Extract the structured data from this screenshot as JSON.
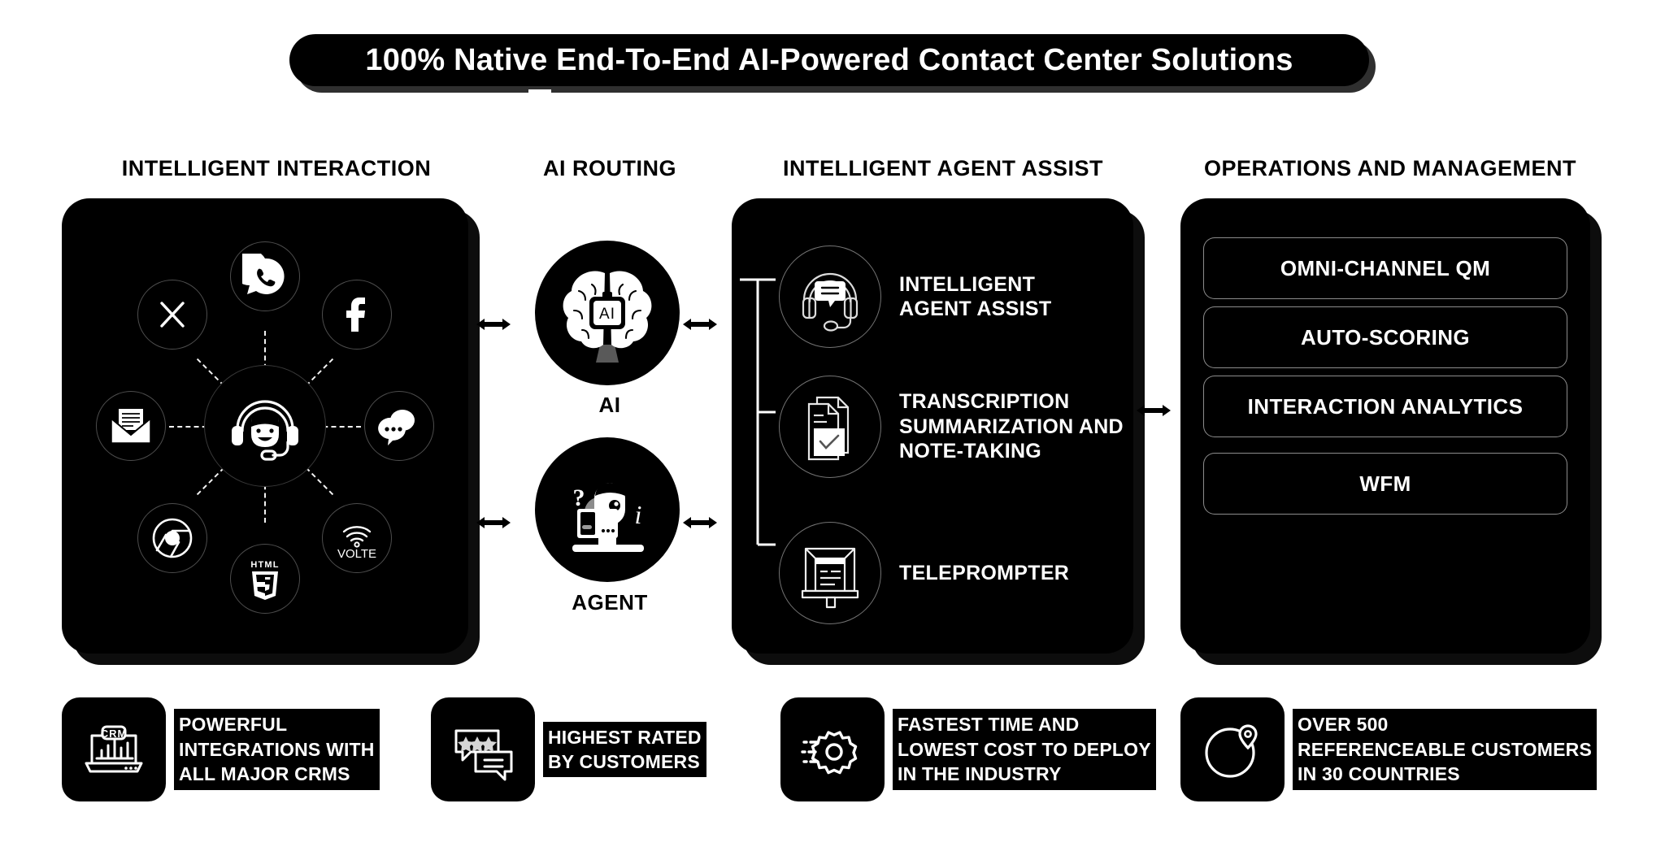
{
  "title": "100% Native End-To-End AI-Powered Contact Center Solutions",
  "columns": {
    "interaction": "INTELLIGENT INTERACTION",
    "routing": "AI ROUTING",
    "assist": "INTELLIGENT AGENT ASSIST",
    "operations": "OPERATIONS AND MANAGEMENT"
  },
  "interaction": {
    "center_icon": "agent-headset-icon",
    "channels": [
      {
        "name": "whatsapp-icon",
        "label": "WhatsApp"
      },
      {
        "name": "x-twitter-icon",
        "label": "X"
      },
      {
        "name": "facebook-icon",
        "label": "Facebook"
      },
      {
        "name": "email-icon",
        "label": "Email"
      },
      {
        "name": "chat-icon",
        "label": "Chat"
      },
      {
        "name": "chrome-icon",
        "label": "Chrome"
      },
      {
        "name": "html5-icon",
        "label": "HTML5"
      },
      {
        "name": "volte-icon",
        "label": "VoLTE"
      }
    ]
  },
  "routing": {
    "nodes": [
      {
        "icon": "ai-brain-icon",
        "caption": "AI"
      },
      {
        "icon": "agent-desk-icon",
        "caption": "AGENT"
      }
    ]
  },
  "assist": {
    "items": [
      {
        "icon": "headset-chat-icon",
        "label": "INTELLIGENT\nAGENT ASSIST"
      },
      {
        "icon": "document-check-icon",
        "label": "TRANSCRIPTION\nSUMMARIZATION AND\nNOTE-TAKING"
      },
      {
        "icon": "teleprompter-icon",
        "label": "TELEPROMPTER"
      }
    ]
  },
  "operations": {
    "items": [
      "OMNI-CHANNEL QM",
      "AUTO-SCORING",
      "INTERACTION ANALYTICS",
      "WFM"
    ]
  },
  "features": [
    {
      "icon": "crm-laptop-icon",
      "text": "POWERFUL\nINTEGRATIONS WITH\nALL MAJOR CRMS"
    },
    {
      "icon": "star-review-icon",
      "text": "HIGHEST RATED\nBY CUSTOMERS"
    },
    {
      "icon": "gear-speed-icon",
      "text": "FASTEST TIME AND\nLOWEST COST TO DEPLOY\nIN THE INDUSTRY"
    },
    {
      "icon": "globe-pin-icon",
      "text": "OVER 500\nREFERENCEABLE CUSTOMERS\nIN 30 COUNTRIES"
    }
  ],
  "colors": {
    "background": "#ffffff",
    "panel": "#000000",
    "text_on_dark": "#ffffff",
    "text_on_light": "#000000",
    "outline": "rgba(255,255,255,0.45)"
  }
}
